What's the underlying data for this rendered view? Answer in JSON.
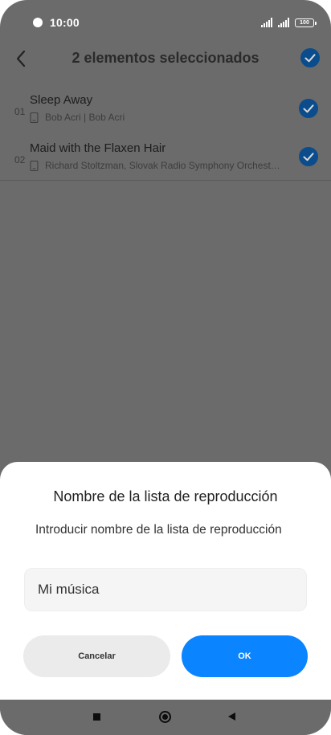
{
  "status_bar": {
    "time": "10:00",
    "battery": "100"
  },
  "header": {
    "title": "2 elementos seleccionados"
  },
  "tracks": [
    {
      "number": "01",
      "title": "Sleep Away",
      "subtitle": "Bob Acri | Bob Acri",
      "selected": true
    },
    {
      "number": "02",
      "title": "Maid with the Flaxen Hair",
      "subtitle": "Richard Stoltzman, Slovak Radio Symphony Orchestra | Mozart",
      "selected": true
    }
  ],
  "dialog": {
    "title": "Nombre de la lista de reproducción",
    "prompt": "Introducir nombre de la lista de reproducción",
    "input_value": "Mi música",
    "cancel_label": "Cancelar",
    "ok_label": "OK"
  },
  "colors": {
    "accent": "#0a84ff",
    "check_blue": "#0b4c8c",
    "dimmed_background": "#6b6b6b"
  },
  "icons": {
    "back": "chevron-left-icon",
    "select_all": "check-circle-icon",
    "track_selected": "check-circle-icon",
    "storage": "phone-storage-icon",
    "nav_recents": "square-icon",
    "nav_home": "circle-home-icon",
    "nav_back": "triangle-back-icon"
  }
}
